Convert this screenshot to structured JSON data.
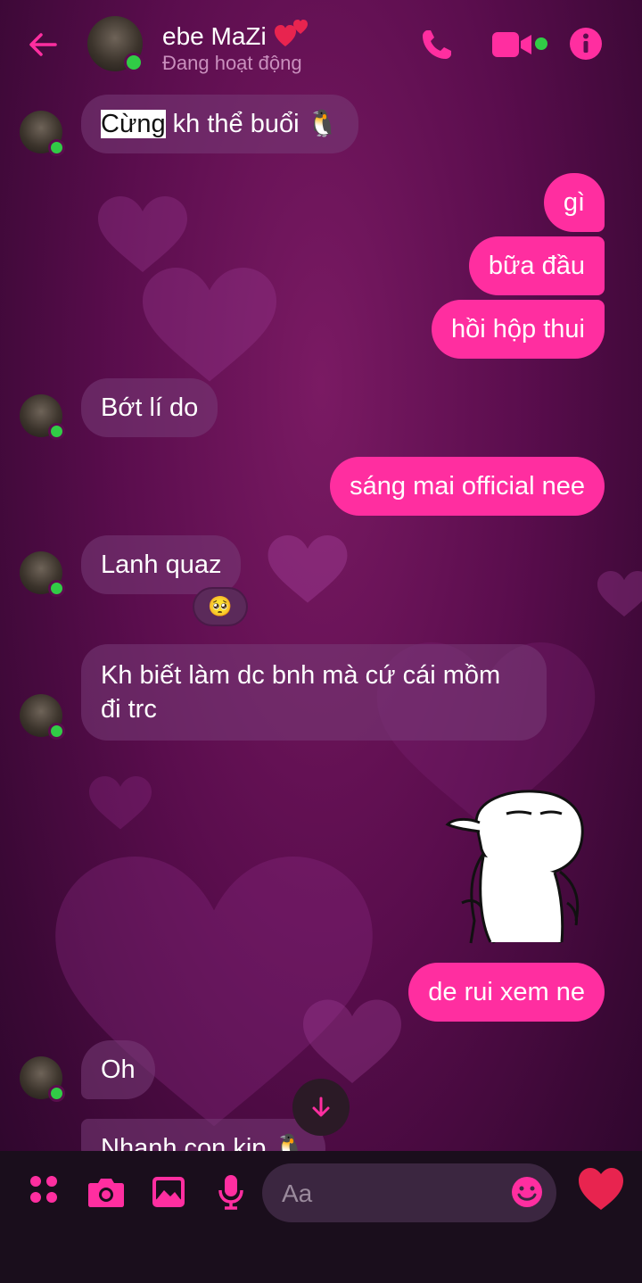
{
  "header": {
    "contact_name": "ebe MaZi",
    "status": "Đang hoạt động"
  },
  "messages": [
    {
      "side": "in",
      "text_highlight": "Cừng",
      "text_rest": " kh thể buổi 🐧"
    },
    {
      "side": "out",
      "text": "gì"
    },
    {
      "side": "out",
      "text": "bữa đầu"
    },
    {
      "side": "out",
      "text": "hồi hộp thui"
    },
    {
      "side": "in",
      "text": "Bớt lí do"
    },
    {
      "side": "out",
      "text": "sáng mai official nee"
    },
    {
      "side": "in",
      "text": "Lanh quaz",
      "reaction": "🥺"
    },
    {
      "side": "in",
      "lines": [
        "Kh biết làm dc bnh mà cứ cái mồm",
        "đi trc"
      ]
    },
    {
      "side": "out",
      "sticker": "shy-stick-figure-sticker"
    },
    {
      "side": "out",
      "text": "de rui xem ne"
    },
    {
      "side": "in",
      "text": "Oh"
    },
    {
      "side": "in",
      "text": "Nhanh con kịp 🐧"
    }
  ],
  "composer": {
    "placeholder": "Aa"
  },
  "colors": {
    "accent": "#ff2ea0",
    "online": "#31cc46"
  }
}
